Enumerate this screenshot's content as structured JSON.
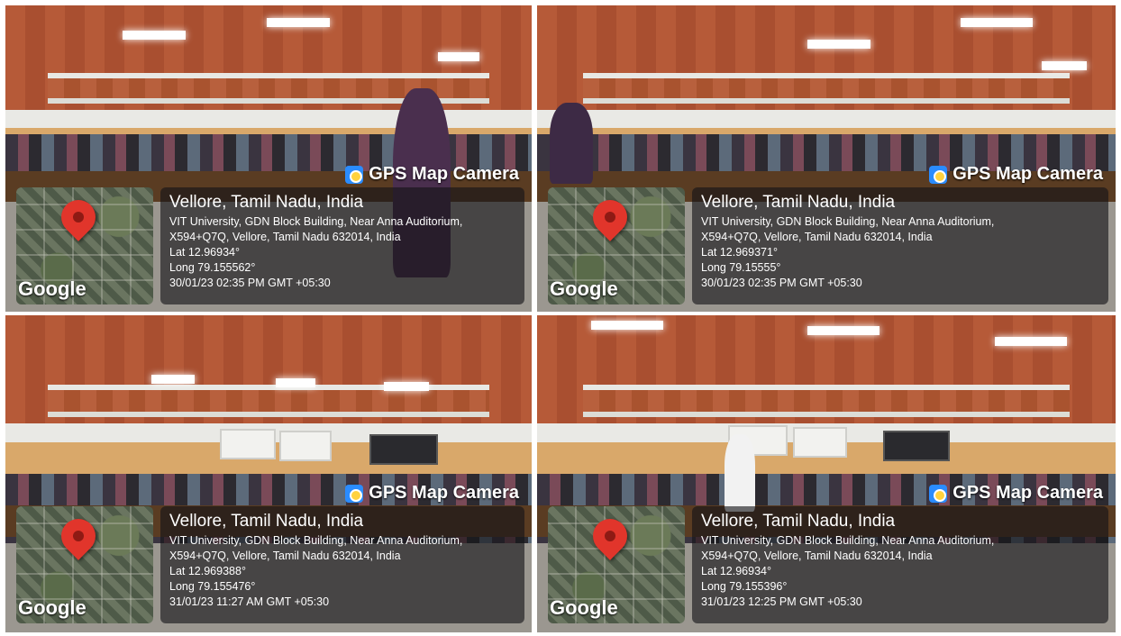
{
  "panels": [
    {
      "brand": "GPS Map Camera",
      "map_logo": "Google",
      "map_icon": "map-pin-icon",
      "city": "Vellore, Tamil Nadu, India",
      "address_line1": "VIT University, GDN Block Building, Near Anna Auditorium,",
      "address_line2": "X594+Q7Q, Vellore, Tamil Nadu 632014, India",
      "lat": "Lat 12.96934°",
      "long": "Long 79.155562°",
      "datetime": "30/01/23 02:35 PM GMT +05:30"
    },
    {
      "brand": "GPS Map Camera",
      "map_logo": "Google",
      "map_icon": "map-pin-icon",
      "city": "Vellore, Tamil Nadu, India",
      "address_line1": "VIT University, GDN Block Building, Near Anna Auditorium,",
      "address_line2": "X594+Q7Q, Vellore, Tamil Nadu 632014, India",
      "lat": "Lat 12.969371°",
      "long": "Long 79.15555°",
      "datetime": "30/01/23 02:35 PM GMT +05:30"
    },
    {
      "brand": "GPS Map Camera",
      "map_logo": "Google",
      "map_icon": "map-pin-icon",
      "city": "Vellore, Tamil Nadu, India",
      "address_line1": "VIT University, GDN Block Building, Near Anna Auditorium,",
      "address_line2": "X594+Q7Q, Vellore, Tamil Nadu 632014, India",
      "lat": "Lat 12.969388°",
      "long": "Long 79.155476°",
      "datetime": "31/01/23 11:27 AM GMT +05:30"
    },
    {
      "brand": "GPS Map Camera",
      "map_logo": "Google",
      "map_icon": "map-pin-icon",
      "city": "Vellore, Tamil Nadu, India",
      "address_line1": "VIT University, GDN Block Building, Near Anna Auditorium,",
      "address_line2": "X594+Q7Q, Vellore, Tamil Nadu 632014, India",
      "lat": "Lat 12.96934°",
      "long": "Long 79.155396°",
      "datetime": "31/01/23 12:25 PM GMT +05:30"
    }
  ]
}
